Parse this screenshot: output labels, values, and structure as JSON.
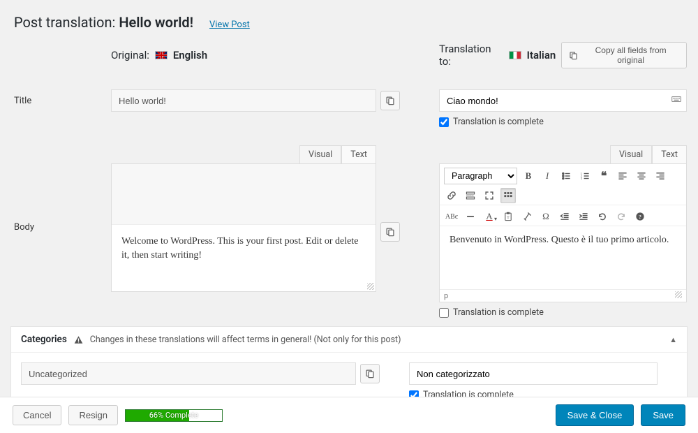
{
  "header": {
    "prefix": "Post translation: ",
    "title": "Hello world!",
    "view_post": "View Post"
  },
  "original": {
    "label": "Original:",
    "language": "English",
    "title_value": "Hello world!",
    "body_text": "Welcome to WordPress. This is your first post. Edit or delete it, then start writing!"
  },
  "translation": {
    "label": "Translation to:",
    "language": "Italian",
    "copy_all": "Copy all fields from original",
    "title_value": "Ciao mondo!",
    "title_complete_label": "Translation is complete",
    "title_complete_checked": true,
    "body_text": "Benvenuto in WordPress. Questo è il tuo primo articolo.",
    "body_complete_label": "Translation is complete",
    "body_complete_checked": false,
    "status_path": "p"
  },
  "field_labels": {
    "title": "Title",
    "body": "Body"
  },
  "tabs": {
    "visual": "Visual",
    "text": "Text"
  },
  "editor": {
    "format_dropdown": "Paragraph"
  },
  "categories": {
    "heading": "Categories",
    "warning": "Changes in these translations will affect terms in general! (Not only for this post)",
    "original_value": "Uncategorized",
    "translation_value": "Non categorizzato",
    "complete_label": "Translation is complete",
    "complete_checked": true
  },
  "footer": {
    "cancel": "Cancel",
    "resign": "Resign",
    "progress_label": "66% Complete",
    "progress_percent": 66,
    "save_close": "Save & Close",
    "save": "Save"
  }
}
